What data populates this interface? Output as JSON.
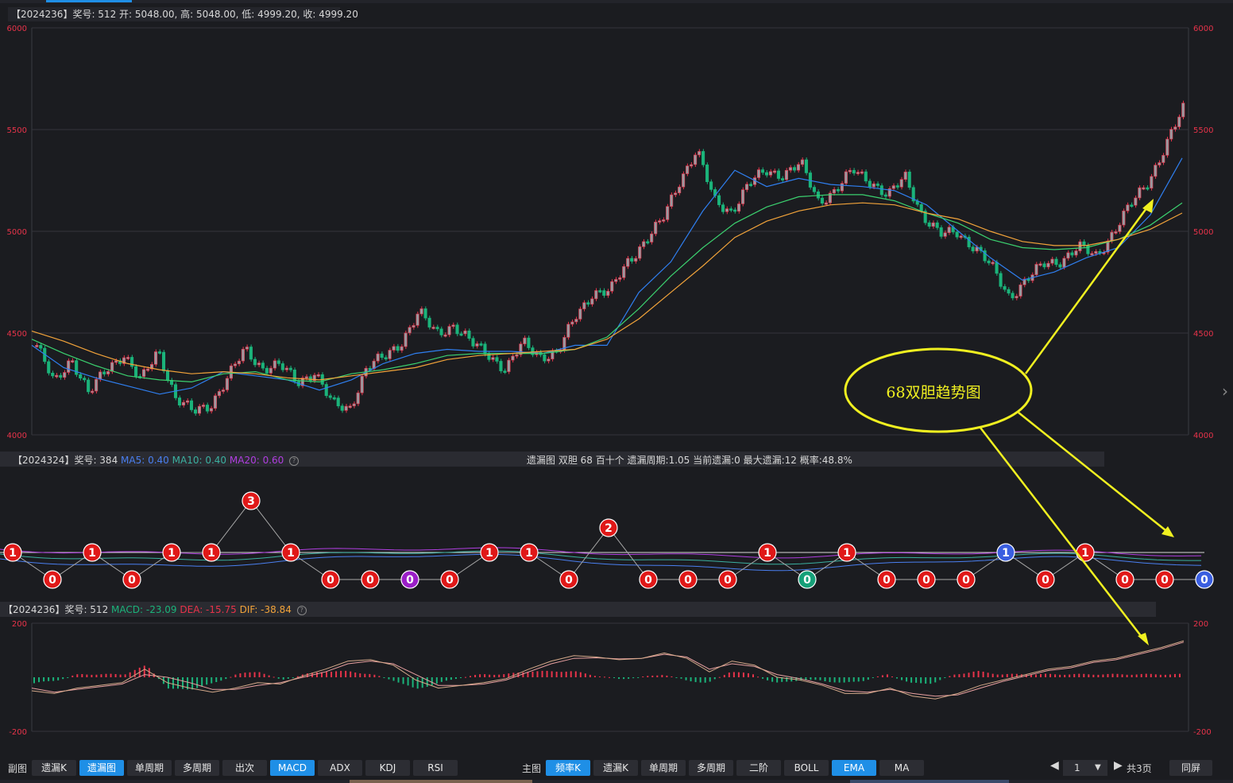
{
  "main_header": "【2024236】奖号: 512  开: 5048.00, 高: 5048.00, 低: 4999.20, 收: 4999.20",
  "sub_header": {
    "prefix": "【2024324】奖号: 384 ",
    "ma5": "MA5: 0.40",
    "ma10": "MA10: 0.40",
    "ma20": "MA20: 0.60",
    "center": "遗漏图   双胆   68   百十个    遗漏周期:1.05   当前遗漏:0    最大遗漏:12    概率:48.8%"
  },
  "macd_header": {
    "prefix": "【2024236】奖号: 512 ",
    "macd": "MACD: -23.09",
    "dea": "DEA: -15.75",
    "dif": "DIF: -38.84"
  },
  "annotation": {
    "text": "68双胆趋势图",
    "color": "#f0f020"
  },
  "colors": {
    "up": "#e8334a",
    "down": "#1bb37a",
    "ma_blue": "#2f7ff0",
    "ma_green": "#3bd16f",
    "ma_orange": "#f2a33a",
    "bg": "#1b1c20"
  },
  "chart_data": [
    {
      "type": "candlestick",
      "ylim": [
        4000,
        6000
      ],
      "yticks": [
        "6000",
        "5500",
        "5000",
        "4500",
        "4000"
      ],
      "close_samples": [
        4440,
        4250,
        4380,
        4200,
        4320,
        4400,
        4260,
        4420,
        4180,
        4110,
        4150,
        4280,
        4420,
        4330,
        4340,
        4260,
        4310,
        4150,
        4130,
        4330,
        4380,
        4460,
        4600,
        4500,
        4540,
        4450,
        4400,
        4320,
        4450,
        4390,
        4400,
        4580,
        4700,
        4700,
        4850,
        4950,
        5050,
        5250,
        5400,
        5150,
        5100,
        5230,
        5300,
        5280,
        5330,
        5150,
        5200,
        5300,
        5250,
        5170,
        5270,
        5080,
        4980,
        5000,
        4920,
        4820,
        4680,
        4760,
        4840,
        4860,
        4920,
        4880,
        5000,
        5130,
        5250,
        5420,
        5600
      ],
      "series": [
        {
          "name": "EMA-blue",
          "values": [
            4440,
            4330,
            4280,
            4240,
            4200,
            4230,
            4310,
            4290,
            4270,
            4220,
            4270,
            4350,
            4400,
            4420,
            4410,
            4410,
            4400,
            4440,
            4440,
            4700,
            4850,
            5100,
            5300,
            5220,
            5260,
            5230,
            5220,
            5200,
            5130,
            5000,
            4870,
            4760,
            4800,
            4870,
            4920,
            5080,
            5360
          ]
        },
        {
          "name": "EMA-green",
          "values": [
            4470,
            4400,
            4340,
            4290,
            4270,
            4260,
            4300,
            4310,
            4270,
            4260,
            4300,
            4320,
            4350,
            4390,
            4400,
            4400,
            4400,
            4420,
            4480,
            4620,
            4780,
            4920,
            5040,
            5120,
            5170,
            5180,
            5180,
            5150,
            5090,
            5040,
            4960,
            4920,
            4910,
            4920,
            4960,
            5030,
            5140
          ]
        },
        {
          "name": "EMA-orange",
          "values": [
            4510,
            4460,
            4400,
            4350,
            4320,
            4300,
            4310,
            4300,
            4280,
            4270,
            4290,
            4310,
            4330,
            4370,
            4390,
            4400,
            4410,
            4420,
            4470,
            4570,
            4700,
            4830,
            4970,
            5050,
            5100,
            5130,
            5140,
            5130,
            5090,
            5060,
            5000,
            4950,
            4930,
            4930,
            4960,
            5010,
            5090
          ]
        }
      ]
    },
    {
      "type": "line",
      "title": "遗漏图 双胆 68",
      "points": [
        {
          "label": "1",
          "color": "#e01818"
        },
        {
          "label": "0",
          "color": "#e01818"
        },
        {
          "label": "1",
          "color": "#e01818"
        },
        {
          "label": "0",
          "color": "#e01818"
        },
        {
          "label": "1",
          "color": "#e01818"
        },
        {
          "label": "1",
          "color": "#e01818"
        },
        {
          "label": "3",
          "color": "#e01818"
        },
        {
          "label": "1",
          "color": "#e01818"
        },
        {
          "label": "0",
          "color": "#e01818"
        },
        {
          "label": "0",
          "color": "#e01818"
        },
        {
          "label": "0",
          "color": "#9a1ec8"
        },
        {
          "label": "0",
          "color": "#e01818"
        },
        {
          "label": "1",
          "color": "#e01818"
        },
        {
          "label": "1",
          "color": "#e01818"
        },
        {
          "label": "0",
          "color": "#e01818"
        },
        {
          "label": "2",
          "color": "#e01818"
        },
        {
          "label": "0",
          "color": "#e01818"
        },
        {
          "label": "0",
          "color": "#e01818"
        },
        {
          "label": "0",
          "color": "#e01818"
        },
        {
          "label": "1",
          "color": "#e01818"
        },
        {
          "label": "0",
          "color": "#16a078"
        },
        {
          "label": "1",
          "color": "#e01818"
        },
        {
          "label": "0",
          "color": "#e01818"
        },
        {
          "label": "0",
          "color": "#e01818"
        },
        {
          "label": "0",
          "color": "#e01818"
        },
        {
          "label": "1",
          "color": "#3a5ee0"
        },
        {
          "label": "0",
          "color": "#e01818"
        },
        {
          "label": "1",
          "color": "#e01818"
        },
        {
          "label": "0",
          "color": "#e01818"
        },
        {
          "label": "0",
          "color": "#e01818"
        },
        {
          "label": "0",
          "color": "#3a5ee0"
        }
      ]
    },
    {
      "type": "bar",
      "title": "MACD",
      "ylim": [
        -200,
        200
      ],
      "yticks": [
        "200",
        "-200"
      ],
      "series": [
        {
          "name": "DIF",
          "values": [
            -50,
            -60,
            -40,
            -30,
            -20,
            30,
            -20,
            -40,
            -55,
            -40,
            -20,
            -25,
            5,
            30,
            60,
            65,
            45,
            -10,
            -40,
            -30,
            -20,
            -5,
            30,
            60,
            80,
            75,
            65,
            70,
            90,
            70,
            20,
            60,
            45,
            0,
            -10,
            -30,
            -60,
            -60,
            -40,
            -70,
            -80,
            -60,
            -30,
            -10,
            10,
            30,
            40,
            60,
            70,
            90,
            110,
            135
          ]
        },
        {
          "name": "DEA",
          "values": [
            -40,
            -55,
            -45,
            -35,
            -25,
            10,
            0,
            -20,
            -45,
            -45,
            -30,
            -20,
            0,
            20,
            50,
            60,
            50,
            10,
            -30,
            -30,
            -25,
            -10,
            20,
            50,
            70,
            72,
            68,
            70,
            85,
            75,
            30,
            50,
            40,
            10,
            -5,
            -25,
            -50,
            -55,
            -45,
            -60,
            -70,
            -65,
            -40,
            -15,
            5,
            25,
            35,
            55,
            65,
            85,
            105,
            130
          ]
        }
      ]
    }
  ],
  "toolbar": {
    "left_label": "副图",
    "left_buttons": [
      {
        "label": "遗漏K",
        "active": false
      },
      {
        "label": "遗漏图",
        "active": true
      },
      {
        "label": "单周期",
        "active": false
      },
      {
        "label": "多周期",
        "active": false
      },
      {
        "label": "出次",
        "active": false
      },
      {
        "label": "MACD",
        "active": true
      },
      {
        "label": "ADX",
        "active": false
      },
      {
        "label": "KDJ",
        "active": false
      },
      {
        "label": "RSI",
        "active": false
      }
    ],
    "main_label": "主图",
    "main_buttons": [
      {
        "label": "频率K",
        "active": true
      },
      {
        "label": "遗漏K",
        "active": false
      },
      {
        "label": "单周期",
        "active": false
      },
      {
        "label": "多周期",
        "active": false
      },
      {
        "label": "二阶",
        "active": false
      },
      {
        "label": "BOLL",
        "active": false
      },
      {
        "label": "EMA",
        "active": true
      },
      {
        "label": "MA",
        "active": false
      }
    ],
    "page_value": "1",
    "page_total": "共3页",
    "fullscreen_label": "同屏"
  }
}
